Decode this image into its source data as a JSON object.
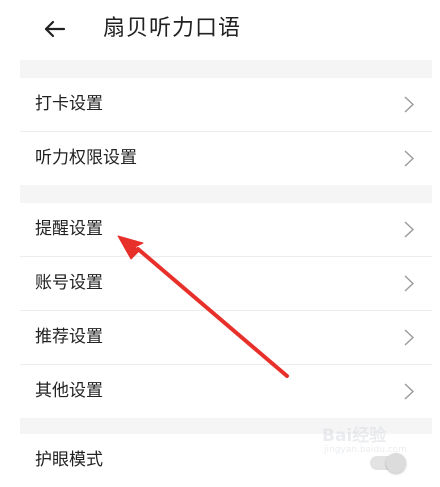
{
  "header": {
    "title": "扇贝听力口语",
    "back_icon": "arrow-left-icon"
  },
  "settings": {
    "group1": [
      {
        "label": "打卡设置"
      },
      {
        "label": "听力权限设置"
      }
    ],
    "group2": [
      {
        "label": "提醒设置"
      },
      {
        "label": "账号设置"
      },
      {
        "label": "推荐设置"
      },
      {
        "label": "其他设置"
      }
    ],
    "group3": [
      {
        "label": "护眼模式",
        "toggle_on": false
      }
    ]
  },
  "annotation": {
    "color": "#e8302a",
    "points_to": "提醒设置"
  },
  "watermark": {
    "text": "Bai经验",
    "sub": "jingyan.baidu.com"
  },
  "colors": {
    "background": "#ffffff",
    "section_gap": "#f5f5f5",
    "divider": "#ececec",
    "chevron": "#9a9a9a"
  }
}
